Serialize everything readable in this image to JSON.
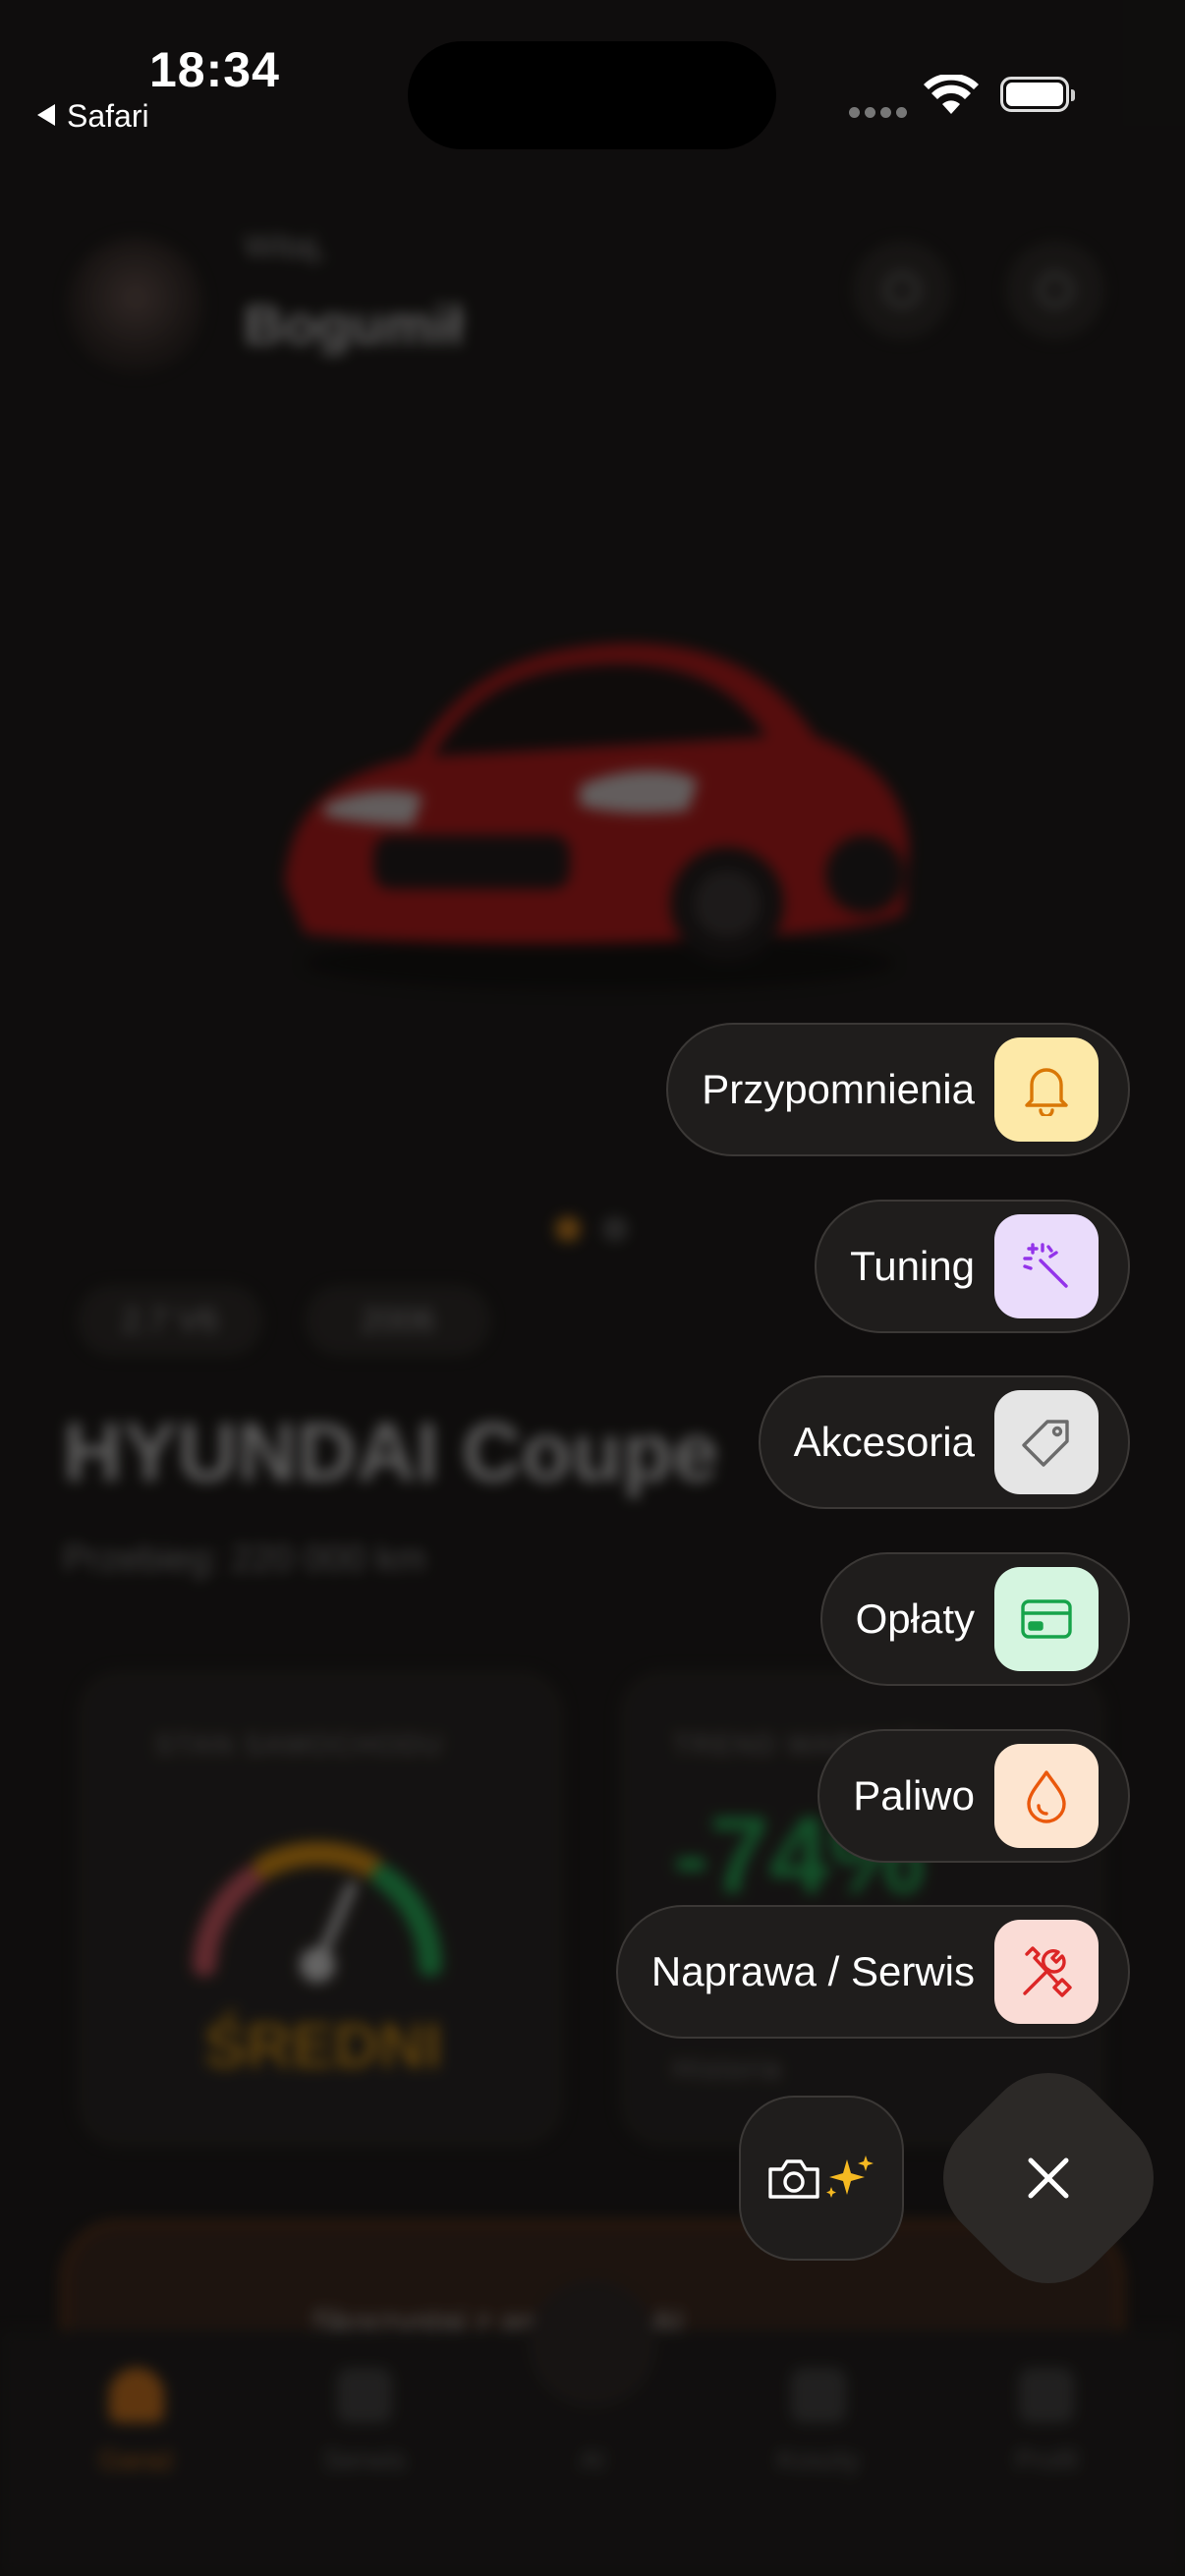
{
  "status_bar": {
    "time": "18:34",
    "back_label": "Safari"
  },
  "background": {
    "greeting": "Witaj,",
    "user_name": "Bogumił",
    "chips": [
      "2.7 V6",
      "2006"
    ],
    "car_title": "HYUNDAI Coupe",
    "mileage": "Przebieg: 220 000 km",
    "condition_card": {
      "label": "STAN SAMOCHODU",
      "value": "ŚREDNI"
    },
    "trend_card": {
      "label": "TREND WARTOŚCI",
      "value": "-74%",
      "note": "Historia"
    },
    "banner_text": "Skorzystaj z asystenta AI",
    "tabs": [
      "Garaż",
      "Serwis",
      "AI",
      "Koszty",
      "Profil"
    ],
    "active_tab": "Garaż"
  },
  "menu": {
    "items": [
      {
        "label": "Przypomnienia",
        "icon": "bell-icon",
        "bg": "#FDE9A8",
        "fg": "#D97706"
      },
      {
        "label": "Tuning",
        "icon": "magic-wand-icon",
        "bg": "#EADCFB",
        "fg": "#9333EA"
      },
      {
        "label": "Akcesoria",
        "icon": "tag-icon",
        "bg": "#E5E5E5",
        "fg": "#6B6B6B"
      },
      {
        "label": "Opłaty",
        "icon": "credit-card-icon",
        "bg": "#D5F5E0",
        "fg": "#16A34A"
      },
      {
        "label": "Paliwo",
        "icon": "fuel-drop-icon",
        "bg": "#FDE5D0",
        "fg": "#EA580C"
      },
      {
        "label": "Naprawa / Serwis",
        "icon": "tools-icon",
        "bg": "#FADCD6",
        "fg": "#DC2626"
      }
    ],
    "camera_button": {
      "icon": "camera-sparkle-icon",
      "sparkle_color": "#F5B921"
    },
    "close_button": {
      "icon": "close-icon"
    }
  }
}
